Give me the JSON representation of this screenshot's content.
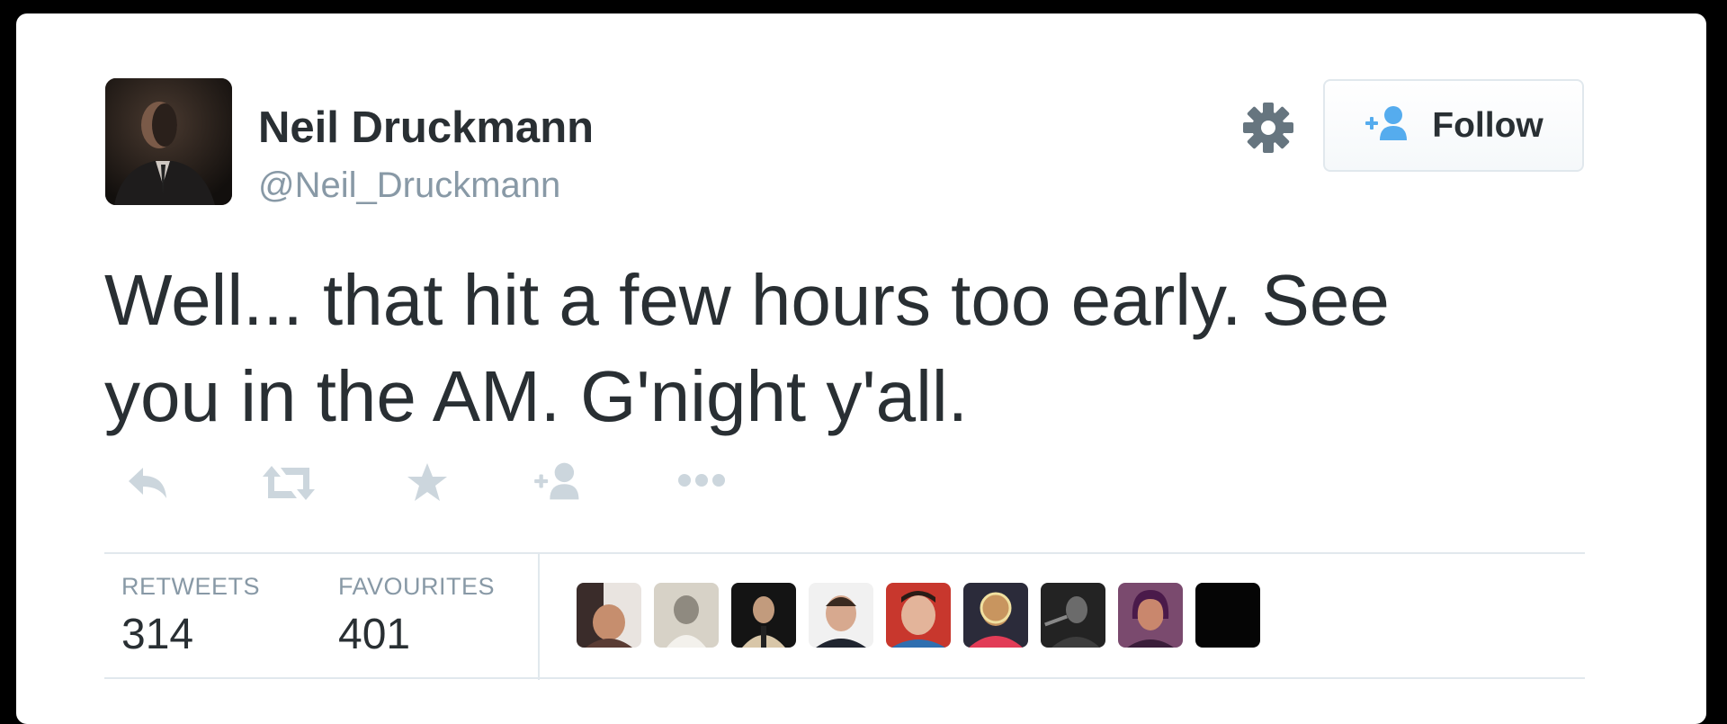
{
  "user": {
    "name": "Neil Druckmann",
    "handle": "@Neil_Druckmann",
    "avatar_icon": "profile-photo"
  },
  "header": {
    "settings_icon": "gear-icon",
    "follow_label": "Follow",
    "follow_icon": "add-user-icon"
  },
  "tweet": {
    "line1": "Well... that hit a few hours too early. See",
    "line2": "you in the AM. G'night y'all."
  },
  "actions": [
    {
      "name": "reply",
      "icon": "reply-icon"
    },
    {
      "name": "retweet",
      "icon": "retweet-icon"
    },
    {
      "name": "favourite",
      "icon": "star-icon"
    },
    {
      "name": "follow",
      "icon": "add-user-icon"
    },
    {
      "name": "more",
      "icon": "more-icon"
    }
  ],
  "stats": {
    "retweets_label": "RETWEETS",
    "retweets_value": "314",
    "favourites_label": "FAVOURITES",
    "favourites_value": "401"
  },
  "colors": {
    "text": "#292f33",
    "muted": "#8899a6",
    "icon": "#ccd6dd",
    "twitter_blue": "#55acee",
    "gear": "#66757f"
  }
}
